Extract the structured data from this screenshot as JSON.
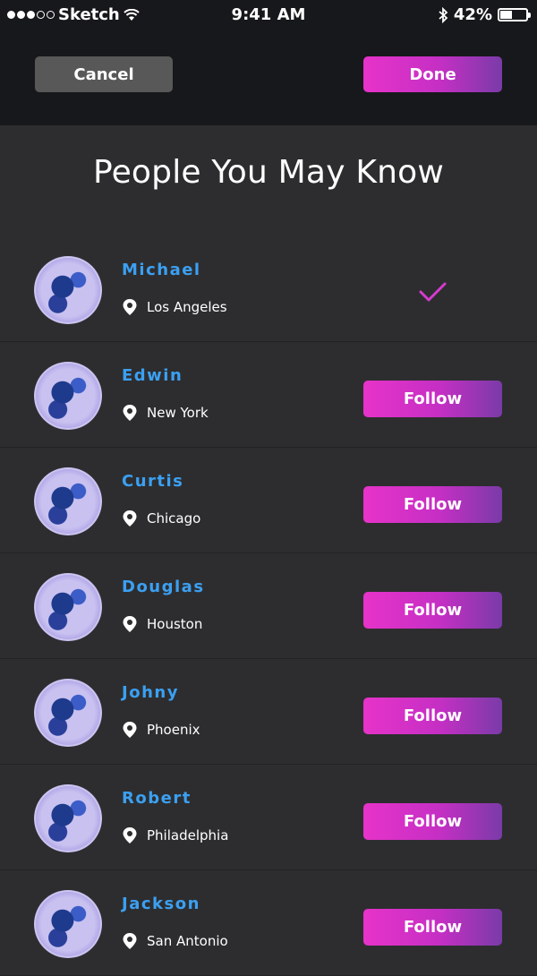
{
  "status_bar": {
    "carrier": "Sketch",
    "time": "9:41 AM",
    "battery": "42%",
    "battery_level": 0.42
  },
  "header": {
    "cancel_label": "Cancel",
    "done_label": "Done"
  },
  "page": {
    "title": "People You May Know"
  },
  "people": [
    {
      "name": "Michael",
      "location": "Los Angeles",
      "following": true
    },
    {
      "name": "Edwin",
      "location": "New York",
      "following": false
    },
    {
      "name": "Curtis",
      "location": "Chicago",
      "following": false
    },
    {
      "name": "Douglas",
      "location": "Houston",
      "following": false
    },
    {
      "name": "Johny",
      "location": "Phoenix",
      "following": false
    },
    {
      "name": "Robert",
      "location": "Philadelphia",
      "following": false
    },
    {
      "name": "Jackson",
      "location": "San Antonio",
      "following": false
    }
  ],
  "follow_label": "Follow",
  "colors": {
    "accent_start": "#e733c9",
    "accent_end": "#7a3ba8",
    "name_color": "#3ba0f2",
    "background": "#2d2d2f",
    "header_bg": "#17181b"
  }
}
